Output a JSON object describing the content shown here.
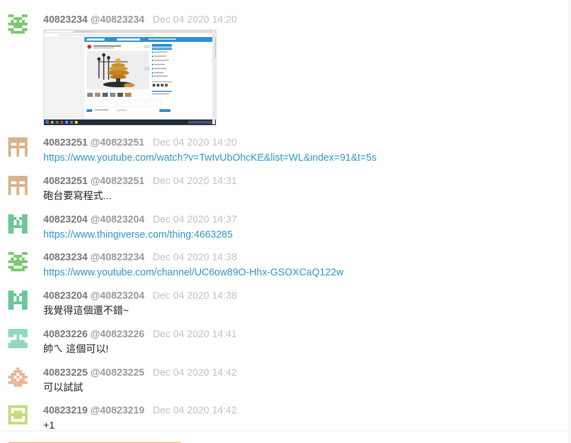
{
  "messages": [
    {
      "name": "40823234",
      "handle": "@40823234",
      "time": "Dec 04 2020 14:20",
      "type": "image",
      "avatar_icon": "identicon-green-invader-icon",
      "avatar_color": "#7bc96f"
    },
    {
      "name": "40823251",
      "handle": "@40823251",
      "time": "Dec 04 2020 14:20",
      "type": "link",
      "text": "https://www.youtube.com/watch?v=TwIvUbOhcKE&list=WL&index=91&t=5s",
      "avatar_icon": "identicon-tan-grid-icon",
      "avatar_color": "#d9b48a"
    },
    {
      "name": "40823251",
      "handle": "@40823251",
      "time": "Dec 04 2020 14:31",
      "type": "text",
      "text": "砲台要寫程式...",
      "avatar_icon": "identicon-tan-grid-icon",
      "avatar_color": "#d9b48a"
    },
    {
      "name": "40823204",
      "handle": "@40823204",
      "time": "Dec 04 2020 14:37",
      "type": "link",
      "text": "https://www.thingiverse.com/thing:4663285",
      "avatar_icon": "identicon-teal-h-icon",
      "avatar_color": "#6fc69a"
    },
    {
      "name": "40823234",
      "handle": "@40823234",
      "time": "Dec 04 2020 14:38",
      "type": "link",
      "text": "https://www.youtube.com/channel/UC6ow89O-Hhx-GSOXCaQ122w",
      "avatar_icon": "identicon-green-invader-icon",
      "avatar_color": "#7bc96f"
    },
    {
      "name": "40823204",
      "handle": "@40823204",
      "time": "Dec 04 2020 14:38",
      "type": "text",
      "text": "我覺得這個還不錯~",
      "avatar_icon": "identicon-teal-h-icon",
      "avatar_color": "#6fc69a"
    },
    {
      "name": "40823226",
      "handle": "@40823226",
      "time": "Dec 04 2020 14:41",
      "type": "text",
      "text": "帥ㄟ 這個可以!",
      "avatar_icon": "identicon-mint-bar-icon",
      "avatar_color": "#8fd8c4"
    },
    {
      "name": "40823225",
      "handle": "@40823225",
      "time": "Dec 04 2020 14:42",
      "type": "text",
      "text": "可以試試",
      "avatar_icon": "identicon-peach-diamond-icon",
      "avatar_color": "#e8b99a"
    },
    {
      "name": "40823219",
      "handle": "@40823219",
      "time": "Dec 04 2020 14:42",
      "type": "text",
      "text": "+1",
      "avatar_icon": "identicon-lime-ladder-icon",
      "avatar_color": "#c3dc7c"
    }
  ]
}
